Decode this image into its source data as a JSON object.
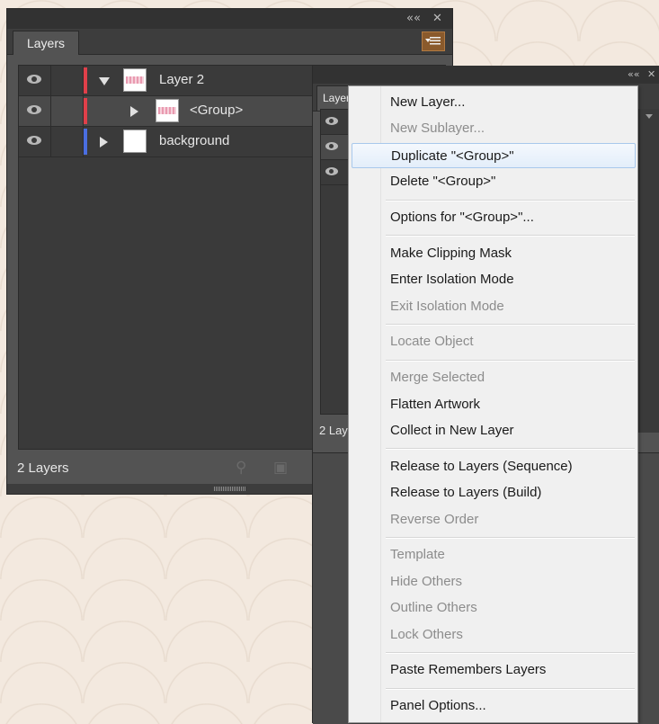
{
  "main_panel": {
    "title_tab": "Layers",
    "collapse_glyph": "««",
    "close_glyph": "✕",
    "layers": [
      {
        "name": "Layer 2",
        "color": "#e0404a",
        "expanded": true,
        "thumb": "pink"
      },
      {
        "name": "<Group>",
        "color": "#e0404a",
        "expanded": false,
        "thumb": "pink",
        "selected": true
      },
      {
        "name": "background",
        "color": "#4a6ee0",
        "expanded": false,
        "thumb": "white"
      }
    ],
    "footer": "2 Layers"
  },
  "second_panel": {
    "title_tab": "Layer",
    "collapse_glyph": "««",
    "close_glyph": "✕",
    "footer": "2 Lay"
  },
  "context_menu": {
    "groups": [
      [
        {
          "label": "New Layer...",
          "enabled": true
        },
        {
          "label": "New Sublayer...",
          "enabled": false
        },
        {
          "label": "Duplicate \"<Group>\"",
          "enabled": true,
          "highlighted": true
        },
        {
          "label": "Delete \"<Group>\"",
          "enabled": true
        }
      ],
      [
        {
          "label": "Options for \"<Group>\"...",
          "enabled": true
        }
      ],
      [
        {
          "label": "Make Clipping Mask",
          "enabled": true
        },
        {
          "label": "Enter Isolation Mode",
          "enabled": true
        },
        {
          "label": "Exit Isolation Mode",
          "enabled": false
        }
      ],
      [
        {
          "label": "Locate Object",
          "enabled": false
        }
      ],
      [
        {
          "label": "Merge Selected",
          "enabled": false
        },
        {
          "label": "Flatten Artwork",
          "enabled": true
        },
        {
          "label": "Collect in New Layer",
          "enabled": true
        }
      ],
      [
        {
          "label": "Release to Layers (Sequence)",
          "enabled": true
        },
        {
          "label": "Release to Layers (Build)",
          "enabled": true
        },
        {
          "label": "Reverse Order",
          "enabled": false
        }
      ],
      [
        {
          "label": "Template",
          "enabled": false
        },
        {
          "label": "Hide Others",
          "enabled": false
        },
        {
          "label": "Outline Others",
          "enabled": false
        },
        {
          "label": "Lock Others",
          "enabled": false
        }
      ],
      [
        {
          "label": "Paste Remembers Layers",
          "enabled": true
        }
      ],
      [
        {
          "label": "Panel Options...",
          "enabled": true
        }
      ]
    ]
  },
  "colors": {
    "panel_bg": "#535353",
    "row_bg": "#3a3a3a",
    "menu_button_accent": "#8a5a2c",
    "menu_highlight_border": "#a8c8ec"
  }
}
